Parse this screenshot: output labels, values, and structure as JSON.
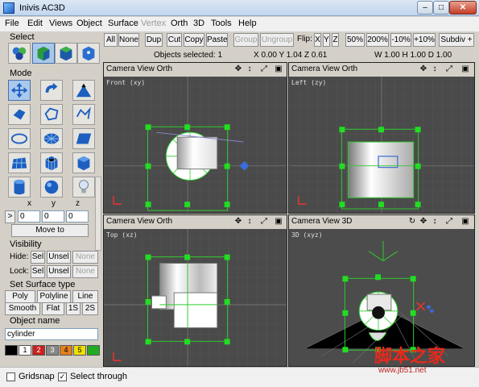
{
  "window": {
    "title": "Inivis AC3D",
    "min_label": "–",
    "max_label": "□",
    "close_label": "✕"
  },
  "menu": [
    "File",
    "Edit",
    "Views",
    "Object",
    "Surface",
    "Vertex",
    "Orth",
    "3D",
    "Tools",
    "Help"
  ],
  "left": {
    "select_label": "Select",
    "mode_label": "Mode",
    "coord_headers": [
      "x",
      "y",
      "z"
    ],
    "coord_values": [
      "0",
      "0",
      "0"
    ],
    "coord_prefix": ">",
    "move_to_label": "Move to",
    "visibility_label": "Visibility",
    "hide_label": "Hide:",
    "lock_label": "Lock:",
    "sel_label": "Sel",
    "unsel_label": "Unsel",
    "none_label": "None",
    "surface_type_label": "Set Surface type",
    "surface_types": [
      "Poly",
      "Polyline",
      "Line",
      "Smooth",
      "Flat",
      "1S",
      "2S"
    ],
    "object_name_label": "Object name",
    "object_name_value": "cylinder",
    "palette_labels": [
      "1",
      "2",
      "3",
      "4",
      "5"
    ],
    "palette_colors": [
      "#000000",
      "#ffffff",
      "#cc2020",
      "#888888",
      "#e08020",
      "#f0e000",
      "#22aa22"
    ]
  },
  "toolbar": {
    "buttons": [
      "All",
      "None",
      "Dup",
      "Cut",
      "Copy",
      "Paste",
      "Group",
      "Ungroup",
      "Flip:",
      "X",
      "Y",
      "Z",
      "50%",
      "200%",
      "-10%",
      "+10%",
      "Subdiv +"
    ],
    "objects_selected": "Objects selected: 1",
    "position": "X 0.00 Y 1.04 Z 0.61",
    "size": "W 1.00 H 1.00 D 1.00"
  },
  "viewports": [
    {
      "header": "Camera  View  Orth",
      "tag": "Front (xy)"
    },
    {
      "header": "Camera  View  Orth",
      "tag": "Left (zy)"
    },
    {
      "header": "Camera  View  Orth",
      "tag": "Top (xz)"
    },
    {
      "header": "Camera  View  3D",
      "tag": "3D (xyz)"
    }
  ],
  "bottom": {
    "gridsnap_label": "Gridsnap",
    "select_through_label": "Select through"
  },
  "watermark": {
    "text": "脚本之家",
    "url": "www.jb51.net"
  }
}
